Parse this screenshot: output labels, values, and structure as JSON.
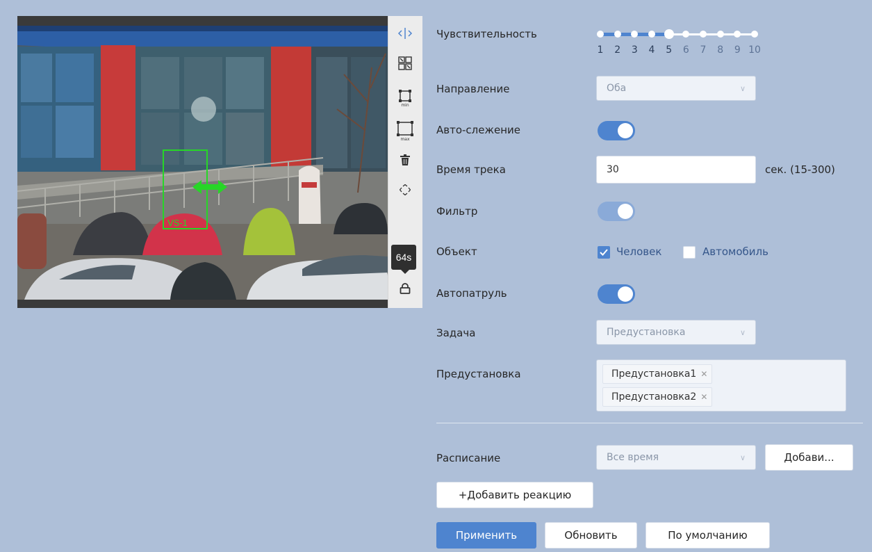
{
  "video": {
    "zone_label": "VS-1",
    "tooltip": "64s"
  },
  "toolbar": {
    "icons": [
      "direction-icon",
      "grid-icon",
      "min-size-icon",
      "max-size-icon",
      "delete-icon",
      "move-icon",
      "lock-icon"
    ]
  },
  "form": {
    "sensitivity": {
      "label": "Чувствительность",
      "value": 5,
      "ticks": [
        "1",
        "2",
        "3",
        "4",
        "5",
        "6",
        "7",
        "8",
        "9",
        "10"
      ]
    },
    "direction": {
      "label": "Направление",
      "value": "Оба"
    },
    "auto_tracking": {
      "label": "Авто-слежение",
      "on": true
    },
    "track_time": {
      "label": "Время трека",
      "value": "30",
      "unit": "сек. (15-300)"
    },
    "filter": {
      "label": "Фильтр",
      "on": true,
      "disabled": true
    },
    "object": {
      "label": "Объект",
      "options": [
        {
          "label": "Человек",
          "checked": true
        },
        {
          "label": "Автомобиль",
          "checked": false
        }
      ]
    },
    "autopatrol": {
      "label": "Автопатруль",
      "on": true
    },
    "task": {
      "label": "Задача",
      "value": "Предустановка"
    },
    "preset": {
      "label": "Предустановка",
      "tags": [
        "Предустановка1",
        "Предустановка2"
      ]
    },
    "schedule": {
      "label": "Расписание",
      "value": "Все время",
      "add_button": "Добави..."
    },
    "add_reaction": "+Добавить реакцию"
  },
  "actions": {
    "apply": "Применить",
    "refresh": "Обновить",
    "default": "По умолчанию"
  },
  "colors": {
    "background": "#aebfd8",
    "accent": "#4e84cf",
    "zone": "#27d627"
  }
}
